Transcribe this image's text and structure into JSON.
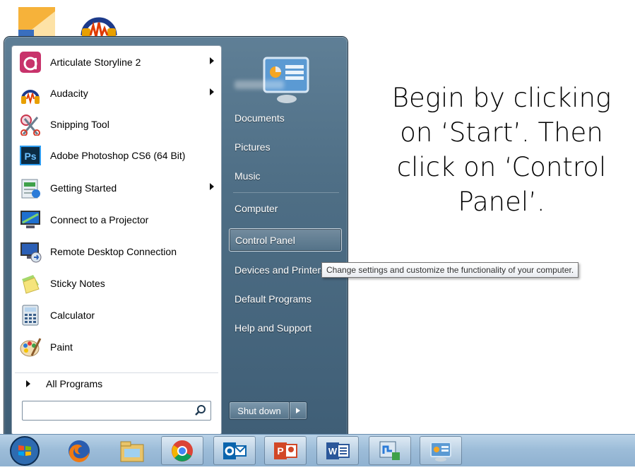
{
  "start_menu": {
    "pinned_items": [
      {
        "label": "Articulate Storyline 2",
        "icon": "articulate-storyline-icon",
        "has_submenu": true
      },
      {
        "label": "Audacity",
        "icon": "audacity-headphones-icon",
        "has_submenu": true
      },
      {
        "label": "Snipping Tool",
        "icon": "scissors-icon",
        "has_submenu": false
      },
      {
        "label": "Adobe Photoshop CS6 (64 Bit)",
        "icon": "photoshop-icon",
        "has_submenu": false
      },
      {
        "label": "Getting Started",
        "icon": "getting-started-icon",
        "has_submenu": true
      },
      {
        "label": "Connect to a Projector",
        "icon": "projector-icon",
        "has_submenu": false
      },
      {
        "label": "Remote Desktop Connection",
        "icon": "remote-desktop-icon",
        "has_submenu": false
      },
      {
        "label": "Sticky Notes",
        "icon": "sticky-notes-icon",
        "has_submenu": false
      },
      {
        "label": "Calculator",
        "icon": "calculator-icon",
        "has_submenu": false
      },
      {
        "label": "Paint",
        "icon": "paint-palette-icon",
        "has_submenu": false
      }
    ],
    "all_programs_label": "All Programs",
    "search_value": "",
    "right_items": {
      "documents": "Documents",
      "pictures": "Pictures",
      "music": "Music",
      "computer": "Computer",
      "control_panel": "Control Panel",
      "devices_printers": "Devices and Printers",
      "default_programs": "Default Programs",
      "help_support": "Help and Support"
    },
    "shutdown_label": "Shut down"
  },
  "tooltip_text": "Change settings and customize the functionality of your computer.",
  "instructions": "Begin by clicking on ‘Start’.  Then click on ‘Control Panel’.",
  "taskbar_items": [
    "start-orb-icon",
    "firefox-icon",
    "file-explorer-icon",
    "chrome-icon",
    "outlook-icon",
    "powerpoint-icon",
    "word-icon",
    "network-icon",
    "control-panel-icon"
  ],
  "colors": {
    "menu_frame": "#4f6f86",
    "taskbar": "#9dbdd9",
    "highlight_border": "#c8d4de"
  }
}
